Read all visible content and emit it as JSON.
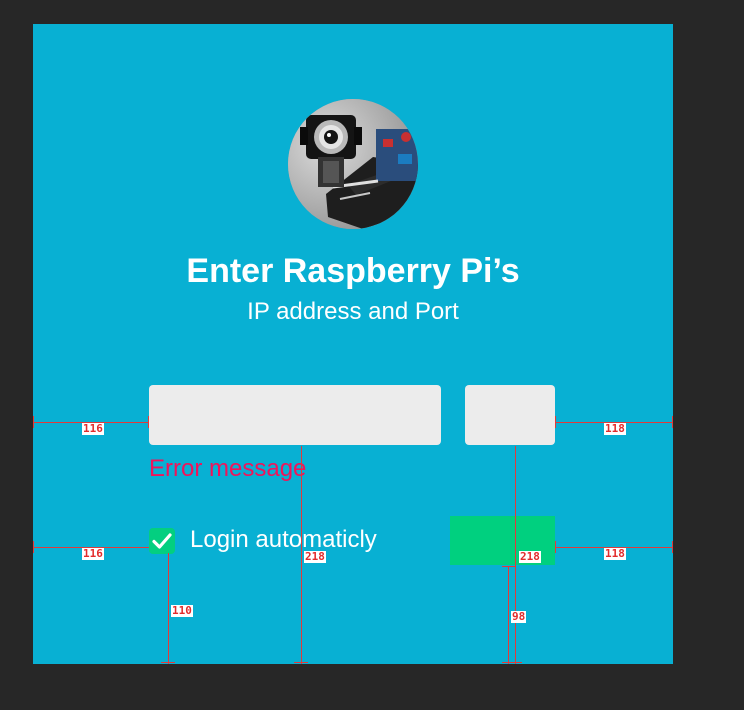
{
  "card": {
    "title": "Enter Raspberry Pi’s",
    "subtitle": "IP address and Port",
    "avatar_icon": "raspberry-pi-camera",
    "ip_field_value": "",
    "port_field_value": "",
    "error": "Error message",
    "auto_login_label": "Login automaticly",
    "auto_login_checked": true,
    "login_button_label": ""
  },
  "colors": {
    "background": "#08b0d3",
    "field": "#ececec",
    "error": "#f0145a",
    "accent": "#00d07f",
    "canvas": "#272727",
    "measure": "#e13a3a"
  },
  "measurements": {
    "fields_left": "116",
    "fields_right": "118",
    "checkbox_left": "116",
    "button_right": "118",
    "ip_field_to_bottom": "218",
    "port_field_to_bottom": "218",
    "checkbox_to_bottom": "110",
    "button_to_bottom": "98"
  }
}
